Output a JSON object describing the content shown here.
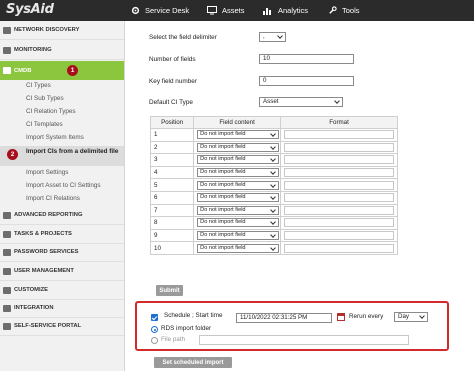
{
  "app": {
    "logo_main": "SysAid",
    "nav": [
      {
        "label": "Service Desk",
        "icon": "cog-icon"
      },
      {
        "label": "Assets",
        "icon": "monitor-icon"
      },
      {
        "label": "Analytics",
        "icon": "bar-chart-icon"
      },
      {
        "label": "Tools",
        "icon": "wrench-icon"
      }
    ]
  },
  "sidebar": {
    "sections": [
      {
        "label": "NETWORK DISCOVERY",
        "icon": "network-icon"
      },
      {
        "label": "MONITORING",
        "icon": "monitoring-icon"
      },
      {
        "label": "CMDB",
        "icon": "cmdb-icon"
      },
      {
        "label": "ADVANCED REPORTING",
        "icon": "reporting-icon"
      },
      {
        "label": "TASKS & PROJECTS",
        "icon": "tasks-icon"
      },
      {
        "label": "PASSWORD SERVICES",
        "icon": "key-icon"
      },
      {
        "label": "USER MANAGEMENT",
        "icon": "user-icon"
      },
      {
        "label": "CUSTOMIZE",
        "icon": "customize-icon"
      },
      {
        "label": "INTEGRATION",
        "icon": "integration-icon"
      },
      {
        "label": "SELF-SERVICE PORTAL",
        "icon": "portal-icon"
      }
    ],
    "cmdb_items": [
      "CI Types",
      "CI Sub Types",
      "CI Relation Types",
      "CI Templates",
      "Import System Items",
      "Import CIs from a delimited file",
      "Import Settings",
      "Import Asset to CI Settings",
      "Import CI Relations"
    ],
    "badges": [
      "1",
      "2"
    ]
  },
  "form": {
    "delimiter_label": "Select the field delimiter",
    "delimiter_value": ",",
    "num_fields_label": "Number of fields",
    "num_fields_value": "10",
    "key_field_label": "Key field number",
    "key_field_value": "0",
    "ci_type_label": "Default CI Type",
    "ci_type_value": "Asset",
    "table_headers": [
      "Position",
      "Field content",
      "Format"
    ],
    "rows": [
      {
        "position": "1",
        "content": "Do not import field"
      },
      {
        "position": "2",
        "content": "Do not import field"
      },
      {
        "position": "3",
        "content": "Do not import field"
      },
      {
        "position": "4",
        "content": "Do not import field"
      },
      {
        "position": "5",
        "content": "Do not import field"
      },
      {
        "position": "6",
        "content": "Do not import field"
      },
      {
        "position": "7",
        "content": "Do not import field"
      },
      {
        "position": "8",
        "content": "Do not import field"
      },
      {
        "position": "9",
        "content": "Do not import field"
      },
      {
        "position": "10",
        "content": "Do not import field"
      }
    ],
    "submit_label": "Submit"
  },
  "schedule": {
    "label": "Schedule ; Start time",
    "start_time": "11/10/2022 02:31:25 PM",
    "rerun_label": "Rerun every",
    "rerun_value": "Day",
    "option_rds": "RDS import folder",
    "option_file": "File path",
    "button_label": "Set scheduled import"
  },
  "colors": {
    "accent": "#8cc63f",
    "highlight_box": "#d42a2a",
    "badge": "#a80f1c",
    "topbar": "#2b2b2b"
  }
}
